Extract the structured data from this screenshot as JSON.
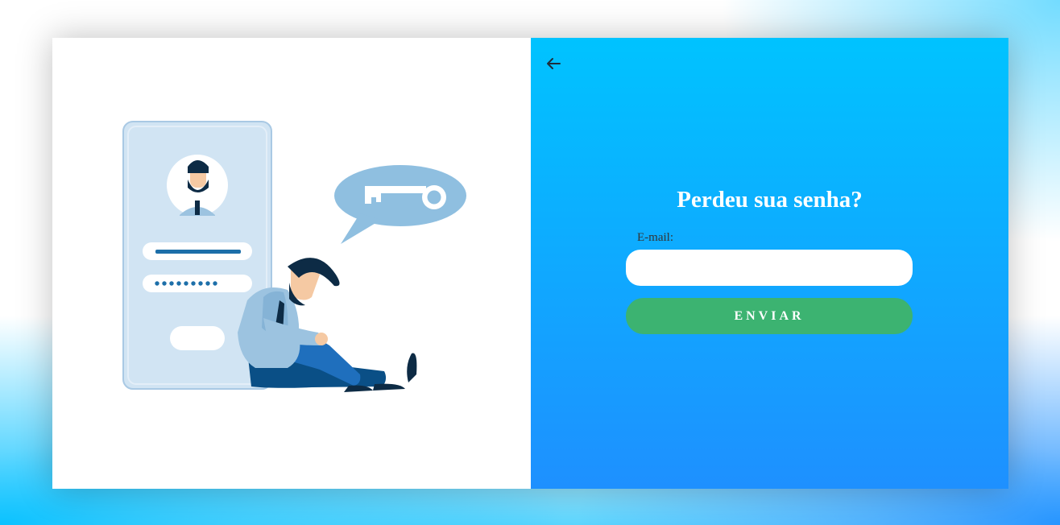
{
  "form": {
    "title": "Perdeu sua senha?",
    "email_label": "E-mail:",
    "email_value": "",
    "email_placeholder": "",
    "submit_label": "ENVIAR"
  },
  "colors": {
    "panel_gradient_top": "#00c3ff",
    "panel_gradient_bottom": "#1e90ff",
    "submit_button": "#3cb371",
    "title_text": "#ffffff"
  },
  "icons": {
    "back": "arrow-left-icon",
    "illustration": "forgot-password-illustration"
  }
}
